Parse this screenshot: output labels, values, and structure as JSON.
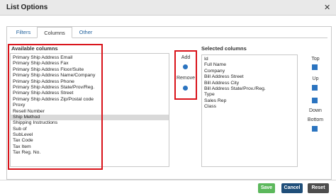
{
  "window": {
    "title": "List Options"
  },
  "tabs": [
    "Filters",
    "Columns",
    "Other"
  ],
  "available": {
    "label": "Available columns",
    "items": [
      "Primary Ship Address Email",
      "Primary Ship Address Fax",
      "Primary Ship Address Floor/Suite",
      "Primary Ship Address Name/Company",
      "Primary Ship Address Phone",
      "Primary Ship Address State/Prov/Reg.",
      "Primary Ship Address Street",
      "Primary Ship Address Zip/Postal code",
      "Proxy",
      "Resell Number",
      "Ship Method",
      "Shipping Instructions",
      "Sub of",
      "SubLevel",
      "Tax Code",
      "Tax Item",
      "Tax Reg. No."
    ],
    "selected_item": "Ship Method"
  },
  "add_remove": {
    "add_label": "Add",
    "remove_label": "Remove"
  },
  "selected": {
    "label": "Selected columns",
    "items": [
      "Id",
      "Full Name",
      "Company",
      "Bill Address Street",
      "Bill Address City",
      "Bill Address State/Prov./Reg.",
      "Type",
      "Sales Rep",
      "Class"
    ]
  },
  "order": {
    "top": "Top",
    "up": "Up",
    "down": "Down",
    "bottom": "Bottom"
  },
  "footer": {
    "save": "Save",
    "cancel": "Cancel",
    "reset": "Reset"
  },
  "colors": {
    "accent": "#2b74c0",
    "highlight": "#d9131a",
    "save": "#5cb85c",
    "cancel": "#1f4e79",
    "reset": "#4d4d4d"
  }
}
